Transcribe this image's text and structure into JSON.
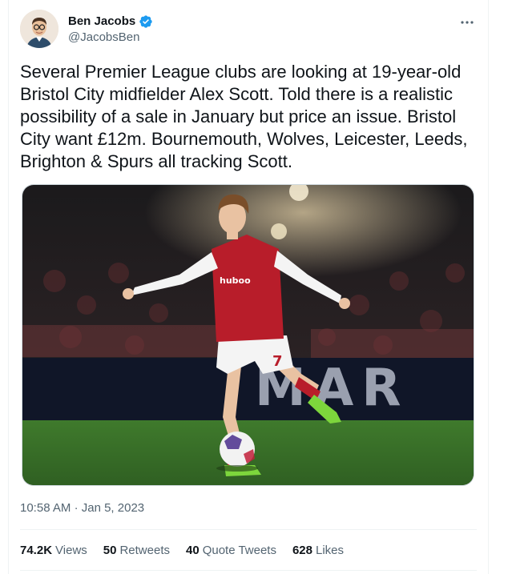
{
  "author": {
    "display_name": "Ben Jacobs",
    "handle": "@JacobsBen",
    "verified": true,
    "verified_color": "#1d9bf0"
  },
  "header": {
    "more_icon": "more-horizontal-icon"
  },
  "tweet": {
    "text": "Several Premier League clubs are looking at 19-year-old Bristol City midfielder Alex Scott. Told there is a realistic possibility of a sale in January but price an issue. Bristol City want £12m. Bournemouth, Wolves, Leicester, Leeds, Brighton & Spurs all tracking Scott.",
    "time": "10:58 AM",
    "separator": "·",
    "date": "Jan 5, 2023"
  },
  "media": {
    "shirt_sponsor": "huboo",
    "shirt_number": "7",
    "board_text": "MAR"
  },
  "stats": {
    "views_count": "74.2K",
    "views_label": "Views",
    "retweets_count": "50",
    "retweets_label": "Retweets",
    "quotes_count": "40",
    "quotes_label": "Quote Tweets",
    "likes_count": "628",
    "likes_label": "Likes"
  }
}
